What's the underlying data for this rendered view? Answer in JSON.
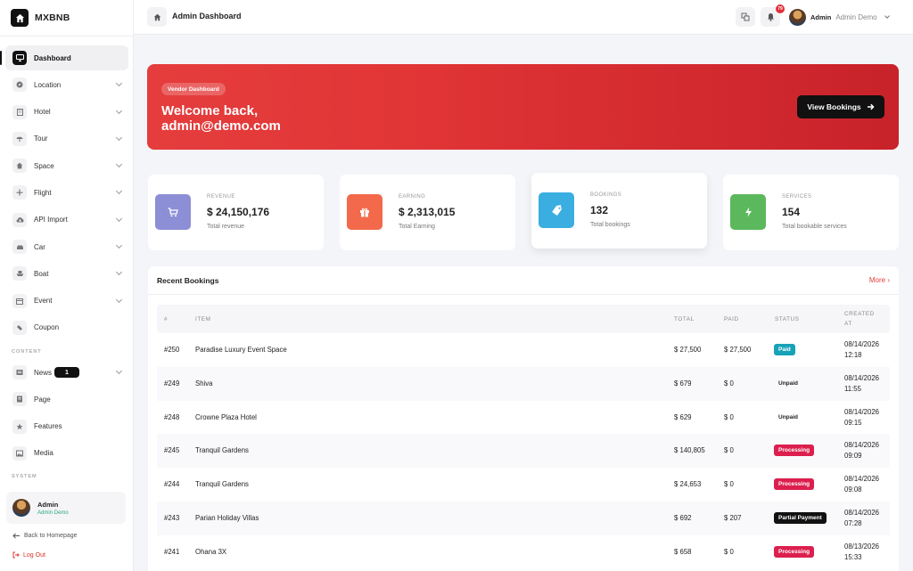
{
  "brand": {
    "name": "MXBNB"
  },
  "sidebar": {
    "items": [
      {
        "label": "Dashboard",
        "icon": "monitor-icon",
        "active": true,
        "chevron": false
      },
      {
        "label": "Location",
        "icon": "compass-icon",
        "chevron": true
      },
      {
        "label": "Hotel",
        "icon": "building-icon",
        "chevron": true
      },
      {
        "label": "Tour",
        "icon": "umbrella-icon",
        "chevron": true
      },
      {
        "label": "Space",
        "icon": "home-icon",
        "chevron": true
      },
      {
        "label": "Flight",
        "icon": "plane-icon",
        "chevron": true
      },
      {
        "label": "API Import",
        "icon": "cloud-download-icon",
        "chevron": true
      },
      {
        "label": "Car",
        "icon": "car-icon",
        "chevron": true
      },
      {
        "label": "Boat",
        "icon": "ship-icon",
        "chevron": true
      },
      {
        "label": "Event",
        "icon": "calendar-icon",
        "chevron": true
      },
      {
        "label": "Coupon",
        "icon": "ticket-icon",
        "chevron": false
      }
    ],
    "content_title": "CONTENT",
    "content_items": [
      {
        "label": "News",
        "icon": "newspaper-icon",
        "chevron": true,
        "badge": "1"
      },
      {
        "label": "Page",
        "icon": "page-icon",
        "chevron": false
      },
      {
        "label": "Features",
        "icon": "star-icon",
        "chevron": false
      },
      {
        "label": "Media",
        "icon": "image-icon",
        "chevron": false
      }
    ],
    "system_title": "SYSTEM",
    "user": {
      "name": "Admin",
      "role": "Admin Demo"
    },
    "back_link": "Back to Homepage",
    "logout_link": "Log Out"
  },
  "topbar": {
    "title": "Admin Dashboard",
    "notification_count": "79",
    "user_name": "Admin",
    "user_role": "Admin Demo"
  },
  "hero": {
    "badge": "Vendor Dashboard",
    "title": "Welcome back, admin@demo.com",
    "button": "View Bookings"
  },
  "stats": [
    {
      "caption": "REVENUE",
      "value": "$ 24,150,176",
      "sub": "Total revenue",
      "color": "#8c8fd6",
      "icon": "cart-icon"
    },
    {
      "caption": "EARNING",
      "value": "$ 2,313,015",
      "sub": "Total Earning",
      "color": "#f26a4b",
      "icon": "gift-icon"
    },
    {
      "caption": "BOOKINGS",
      "value": "132",
      "sub": "Total bookings",
      "color": "#3aaee0",
      "icon": "tag-icon"
    },
    {
      "caption": "SERVICES",
      "value": "154",
      "sub": "Total bookable services",
      "color": "#5cb85c",
      "icon": "bolt-icon"
    }
  ],
  "bookings": {
    "title": "Recent Bookings",
    "more": "More",
    "headers": {
      "id": "#",
      "item": "ITEM",
      "total": "TOTAL",
      "paid": "PAID",
      "status": "STATUS",
      "created": "CREATED AT"
    },
    "rows": [
      {
        "id": "#250",
        "item": "Paradise Luxury Event Space",
        "total": "$ 27,500",
        "paid": "$ 27,500",
        "status": "Paid",
        "status_color": "#17a2b8",
        "date": "08/14/2026",
        "time": "12:18"
      },
      {
        "id": "#249",
        "item": "Shiva",
        "total": "$ 679",
        "paid": "$ 0",
        "status": "Unpaid",
        "status_color": "transparent",
        "date": "08/14/2026",
        "time": "11:55"
      },
      {
        "id": "#248",
        "item": "Crowne Plaza Hotel",
        "total": "$ 629",
        "paid": "$ 0",
        "status": "Unpaid",
        "status_color": "transparent",
        "date": "08/14/2026",
        "time": "09:15"
      },
      {
        "id": "#245",
        "item": "Tranquil Gardens",
        "total": "$ 140,805",
        "paid": "$ 0",
        "status": "Processing",
        "status_color": "#dc1f4e",
        "date": "08/14/2026",
        "time": "09:09"
      },
      {
        "id": "#244",
        "item": "Tranquil Gardens",
        "total": "$ 24,653",
        "paid": "$ 0",
        "status": "Processing",
        "status_color": "#dc1f4e",
        "date": "08/14/2026",
        "time": "09:08"
      },
      {
        "id": "#243",
        "item": "Parian Holiday Villas",
        "total": "$ 692",
        "paid": "$ 207",
        "status": "Partial Payment",
        "status_color": "#111111",
        "date": "08/14/2026",
        "time": "07:28"
      },
      {
        "id": "#241",
        "item": "Ohana 3X",
        "total": "$ 658",
        "paid": "$ 0",
        "status": "Processing",
        "status_color": "#dc1f4e",
        "date": "08/13/2026",
        "time": "15:33"
      }
    ]
  }
}
